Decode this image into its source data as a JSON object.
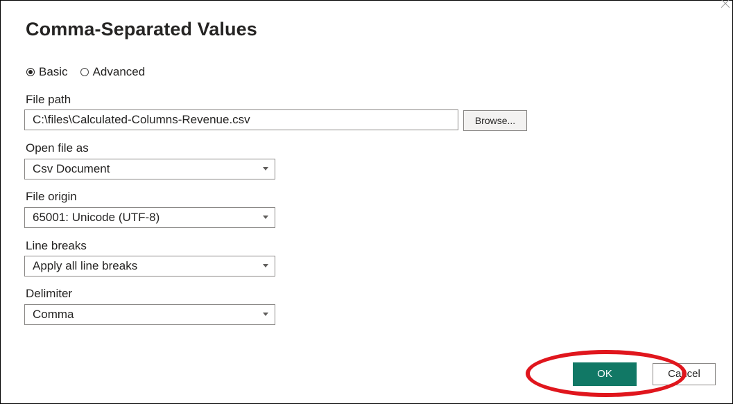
{
  "dialog": {
    "title": "Comma-Separated Values"
  },
  "mode": {
    "basic_label": "Basic",
    "advanced_label": "Advanced",
    "selected": "Basic"
  },
  "file_path": {
    "label": "File path",
    "value": "C:\\files\\Calculated-Columns-Revenue.csv",
    "browse_label": "Browse..."
  },
  "open_file_as": {
    "label": "Open file as",
    "value": "Csv Document"
  },
  "file_origin": {
    "label": "File origin",
    "value": "65001: Unicode (UTF-8)"
  },
  "line_breaks": {
    "label": "Line breaks",
    "value": "Apply all line breaks"
  },
  "delimiter": {
    "label": "Delimiter",
    "value": "Comma"
  },
  "footer": {
    "ok_label": "OK",
    "cancel_label": "Cancel"
  },
  "colors": {
    "ok_button": "#117865",
    "highlight_ellipse": "#e0161d"
  },
  "icons": {
    "close": "close-icon",
    "dropdown": "chevron-down-icon"
  }
}
